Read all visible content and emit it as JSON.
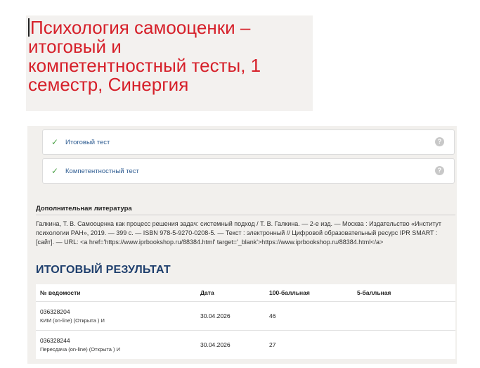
{
  "title": {
    "line1": "Психология самооценки –",
    "line2": "итоговый и",
    "line3": "компетентностный тесты, 1",
    "line4": "семестр, Синергия"
  },
  "tests": [
    {
      "label": "Итоговый тест",
      "help": "?"
    },
    {
      "label": "Компетентностный тест",
      "help": "?"
    }
  ],
  "literature": {
    "heading": "Дополнительная литература",
    "text": "Галкина, Т. В. Самооценка как процесс решения задач: системный подход / Т. В. Галкина. — 2-е изд. — Москва : Издательство «Институт психологии РАН», 2019. — 399 с. — ISBN 978-5-9270-0208-5. — Текст : электронный // Цифровой образовательный ресурс IPR SMART : [сайт]. — URL: <a href='https://www.iprbookshop.ru/88384.html' target='_blank'>https://www.iprbookshop.ru/88384.html</a>"
  },
  "result": {
    "heading": "ИТОГОВЫЙ РЕЗУЛЬТАТ",
    "columns": [
      "№ ведомости",
      "Дата",
      "100-балльная",
      "5-балльная"
    ],
    "rows": [
      {
        "number": "036328204",
        "type": "КИМ (on-line) (Открыта ) И",
        "date": "30.04.2026",
        "score100": "46",
        "score5": ""
      },
      {
        "number": "036328244",
        "type": "Пересдача (on-line) (Открыта ) И",
        "date": "30.04.2026",
        "score100": "27",
        "score5": ""
      }
    ]
  },
  "colors": {
    "title_red": "#d6202a",
    "heading_blue": "#1f3f6d",
    "link_blue": "#2d5b91",
    "check_green": "#4fa34a"
  }
}
